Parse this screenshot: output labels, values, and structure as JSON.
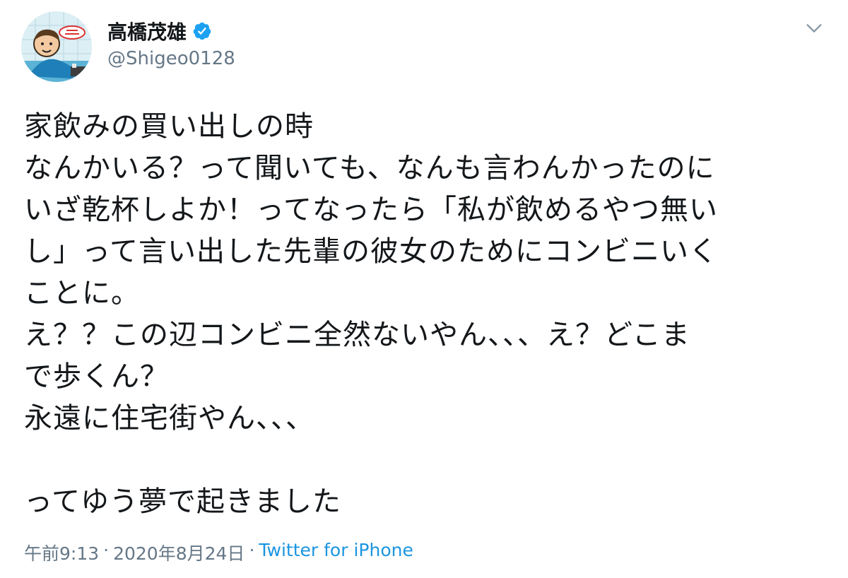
{
  "user": {
    "display_name": "高橋茂雄",
    "handle": "@Shigeo0128",
    "verified": true
  },
  "tweet": {
    "text": "家飲みの買い出しの時\nなんかいる？って聞いても、なんも言わんかったのに\nいざ乾杯しよか！ってなったら「私が飲めるやつ無い\nし」って言い出した先輩の彼女のためにコンビニいく\nことに。\nえ？？この辺コンビニ全然ないやん、、、え？どこま\nで歩くん？\n永遠に住宅街やん、、、\n\nってゆう夢で起きました",
    "time": "午前9:13",
    "separator": "·",
    "date": "2020年8月24日",
    "source_separator": "·",
    "source": "Twitter for iPhone"
  },
  "colors": {
    "verified_badge": "#1da1f2",
    "source_link": "#1b95e0",
    "secondary_text": "#657786"
  },
  "icons": {
    "verified": "verified-badge-icon",
    "menu": "chevron-down-icon"
  }
}
